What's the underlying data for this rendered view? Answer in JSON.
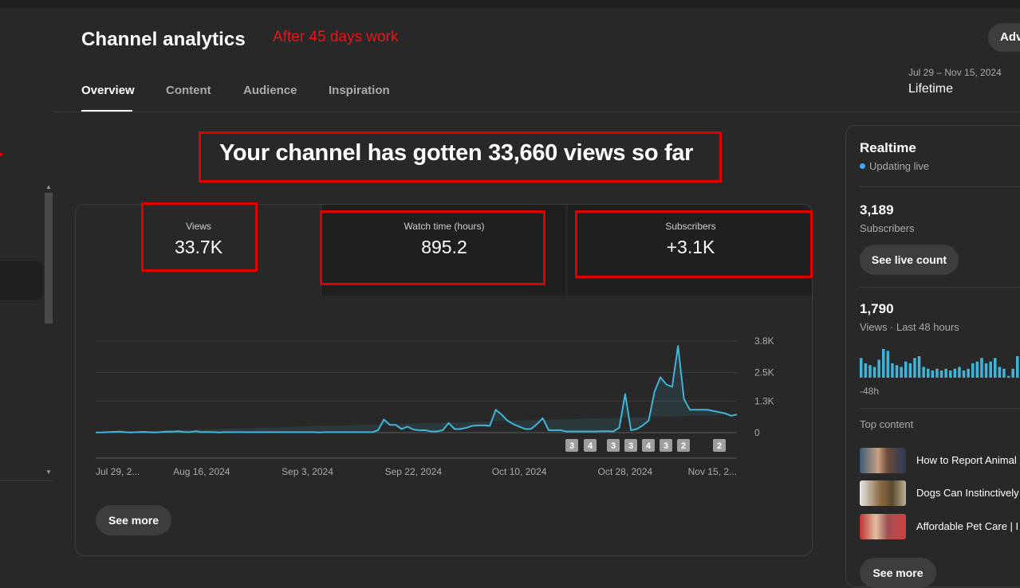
{
  "header": {
    "title": "Channel analytics",
    "annotation": "After 45 days work",
    "advanced_button": "Adv",
    "date_range": "Jul 29 – Nov 15, 2024",
    "date_label": "Lifetime"
  },
  "tabs": [
    {
      "label": "Overview",
      "active": true
    },
    {
      "label": "Content",
      "active": false
    },
    {
      "label": "Audience",
      "active": false
    },
    {
      "label": "Inspiration",
      "active": false
    }
  ],
  "headline": "Your channel has gotten 33,660 views so far",
  "metrics": {
    "views": {
      "label": "Views",
      "value": "33.7K"
    },
    "watch_time": {
      "label": "Watch time (hours)",
      "value": "895.2"
    },
    "subscribers": {
      "label": "Subscribers",
      "value": "+3.1K"
    }
  },
  "chart_data": {
    "type": "area",
    "title": "",
    "xlabel": "",
    "ylabel": "",
    "x_tick_labels": [
      "Jul 29, 2...",
      "Aug 16, 2024",
      "Sep 3, 2024",
      "Sep 22, 2024",
      "Oct 10, 2024",
      "Oct 28, 2024",
      "Nov 15, 2..."
    ],
    "y_tick_labels": [
      "3.8K",
      "2.5K",
      "1.3K",
      "0"
    ],
    "ylim": [
      0,
      3800
    ],
    "grid": true,
    "color": "#41b4d9",
    "days": [
      "2024-07-29",
      "2024-07-30",
      "2024-07-31",
      "2024-08-01",
      "2024-08-02",
      "2024-08-03",
      "2024-08-04",
      "2024-08-05",
      "2024-08-06",
      "2024-08-07",
      "2024-08-08",
      "2024-08-09",
      "2024-08-10",
      "2024-08-11",
      "2024-08-12",
      "2024-08-13",
      "2024-08-14",
      "2024-08-15",
      "2024-08-16",
      "2024-08-17",
      "2024-08-18",
      "2024-08-19",
      "2024-08-20",
      "2024-08-21",
      "2024-08-22",
      "2024-08-23",
      "2024-08-24",
      "2024-08-25",
      "2024-08-26",
      "2024-08-27",
      "2024-08-28",
      "2024-08-29",
      "2024-08-30",
      "2024-08-31",
      "2024-09-01",
      "2024-09-02",
      "2024-09-03",
      "2024-09-04",
      "2024-09-05",
      "2024-09-06",
      "2024-09-07",
      "2024-09-08",
      "2024-09-09",
      "2024-09-10",
      "2024-09-11",
      "2024-09-12",
      "2024-09-13",
      "2024-09-14",
      "2024-09-15",
      "2024-09-16",
      "2024-09-17",
      "2024-09-18",
      "2024-09-19",
      "2024-09-20",
      "2024-09-21",
      "2024-09-22",
      "2024-09-23",
      "2024-09-24",
      "2024-09-25",
      "2024-09-26",
      "2024-09-27",
      "2024-09-28",
      "2024-09-29",
      "2024-09-30",
      "2024-10-01",
      "2024-10-02",
      "2024-10-03",
      "2024-10-04",
      "2024-10-05",
      "2024-10-06",
      "2024-10-07",
      "2024-10-08",
      "2024-10-09",
      "2024-10-10",
      "2024-10-11",
      "2024-10-12",
      "2024-10-13",
      "2024-10-14",
      "2024-10-15",
      "2024-10-16",
      "2024-10-17",
      "2024-10-18",
      "2024-10-19",
      "2024-10-20",
      "2024-10-21",
      "2024-10-22",
      "2024-10-23",
      "2024-10-24",
      "2024-10-25",
      "2024-10-26",
      "2024-10-27",
      "2024-10-28",
      "2024-10-29",
      "2024-10-30",
      "2024-10-31",
      "2024-11-01",
      "2024-11-02",
      "2024-11-03",
      "2024-11-04",
      "2024-11-05",
      "2024-11-06",
      "2024-11-07",
      "2024-11-08",
      "2024-11-09",
      "2024-11-10",
      "2024-11-11",
      "2024-11-12",
      "2024-11-13",
      "2024-11-14",
      "2024-11-15"
    ],
    "values": [
      10,
      10,
      20,
      30,
      40,
      20,
      10,
      20,
      30,
      20,
      10,
      20,
      40,
      40,
      60,
      30,
      20,
      60,
      20,
      30,
      20,
      10,
      20,
      20,
      20,
      20,
      20,
      20,
      20,
      20,
      20,
      20,
      20,
      20,
      20,
      20,
      20,
      20,
      10,
      20,
      20,
      20,
      20,
      20,
      20,
      20,
      20,
      20,
      100,
      550,
      320,
      320,
      150,
      250,
      130,
      100,
      100,
      50,
      50,
      100,
      400,
      150,
      150,
      200,
      280,
      300,
      300,
      280,
      950,
      750,
      500,
      350,
      250,
      150,
      150,
      350,
      600,
      100,
      100,
      100,
      50,
      50,
      50,
      50,
      50,
      50,
      60,
      60,
      50,
      200,
      1600,
      100,
      150,
      300,
      500,
      1700,
      2300,
      2000,
      1900,
      3600,
      1400,
      950,
      950,
      950,
      950,
      900,
      850,
      800,
      700,
      750,
      650,
      1300
    ]
  },
  "chart_markers": [
    {
      "label": "3"
    },
    {
      "label": "4"
    },
    {
      "label": "3"
    },
    {
      "label": "3"
    },
    {
      "label": "4"
    },
    {
      "label": "3"
    },
    {
      "label": "2"
    },
    {
      "label": "2"
    }
  ],
  "see_more": "See more",
  "realtime": {
    "title": "Realtime",
    "status": "Updating live",
    "subscribers_count": "3,189",
    "subscribers_label": "Subscribers",
    "live_count_button": "See live count",
    "views_count": "1,790",
    "views_label": "Views · Last 48 hours",
    "bars_label": "-48h",
    "bar_values": [
      55,
      40,
      35,
      30,
      50,
      80,
      75,
      40,
      35,
      30,
      45,
      40,
      55,
      60,
      30,
      25,
      20,
      25,
      20,
      25,
      20,
      25,
      30,
      20,
      25,
      40,
      45,
      55,
      40,
      45,
      55,
      30,
      25,
      5,
      25,
      60
    ],
    "top_content_label": "Top content",
    "top_items": [
      {
        "title": "How to Report Animal"
      },
      {
        "title": "Dogs Can Instinctively"
      },
      {
        "title": "Affordable Pet Care | I"
      }
    ],
    "see_more": "See more"
  }
}
